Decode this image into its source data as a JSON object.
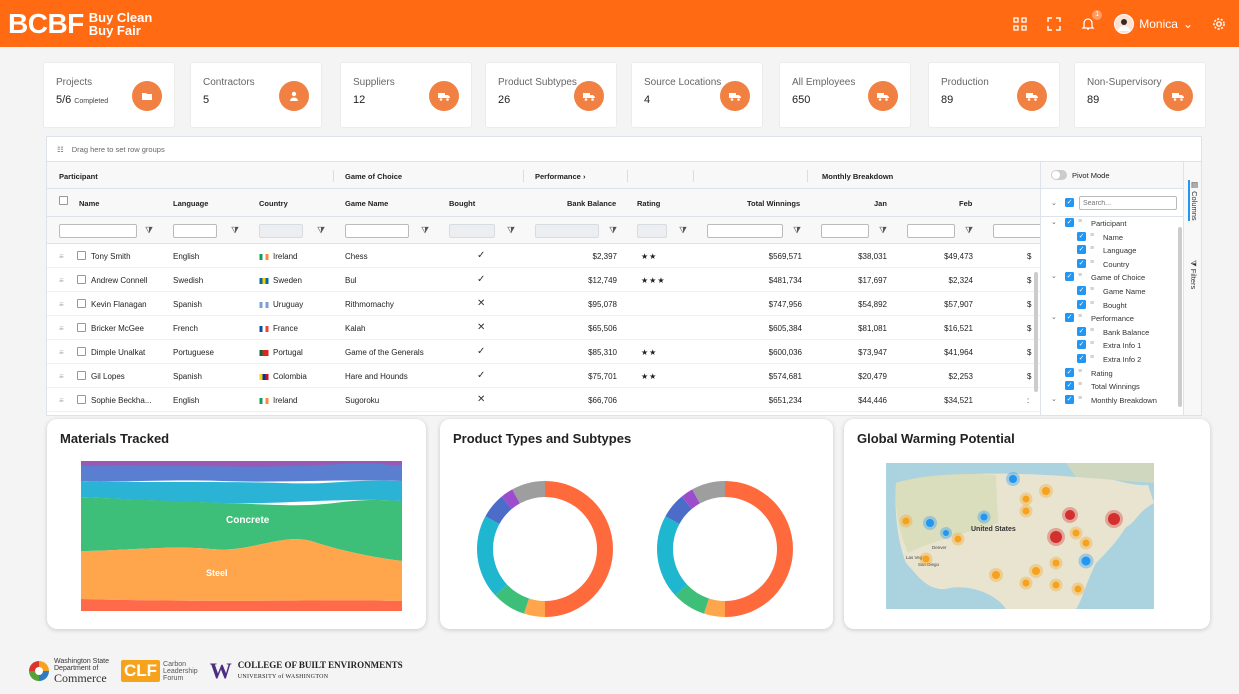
{
  "header": {
    "logo": "BCBF",
    "subtitle_line1": "Buy Clean",
    "subtitle_line2": "Buy Fair",
    "user_name": "Monica",
    "notification_count": "1",
    "brand_color": "#ff6a13"
  },
  "stats": [
    {
      "label": "Projects",
      "value": "5/6",
      "sub": "Completed",
      "icon": "folder-icon"
    },
    {
      "label": "Contractors",
      "value": "5",
      "sub": "",
      "icon": "person-icon"
    },
    {
      "label": "Suppliers",
      "value": "12",
      "sub": "",
      "icon": "truck-icon"
    },
    {
      "label": "Product Subtypes",
      "value": "26",
      "sub": "",
      "icon": "truck-icon"
    },
    {
      "label": "Source Locations",
      "value": "4",
      "sub": "",
      "icon": "truck-icon"
    },
    {
      "label": "All Employees",
      "value": "650",
      "sub": "",
      "icon": "truck-icon"
    },
    {
      "label": "Production",
      "value": "89",
      "sub": "",
      "icon": "truck-icon"
    },
    {
      "label": "Non-Supervisory",
      "value": "89",
      "sub": "",
      "icon": "truck-icon"
    }
  ],
  "grid": {
    "row_group_hint": "Drag here to set row groups",
    "groups": {
      "participant": "Participant",
      "game": "Game of Choice",
      "performance": "Performance",
      "monthly": "Monthly Breakdown"
    },
    "columns": {
      "name": "Name",
      "language": "Language",
      "country": "Country",
      "game_name": "Game Name",
      "bought": "Bought",
      "bank_balance": "Bank Balance",
      "rating": "Rating",
      "total_winnings": "Total Winnings",
      "jan": "Jan",
      "feb": "Feb"
    },
    "rows": [
      {
        "name": "Tony Smith",
        "language": "English",
        "country": "Ireland",
        "game": "Chess",
        "bought": "✓",
        "balance": "$2,397",
        "rating": "★★",
        "winnings": "$569,571",
        "jan": "$38,031",
        "feb": "$49,473",
        "more": "$"
      },
      {
        "name": "Andrew Connell",
        "language": "Swedish",
        "country": "Sweden",
        "game": "Bul",
        "bought": "✓",
        "balance": "$12,749",
        "rating": "★★★",
        "winnings": "$481,734",
        "jan": "$17,697",
        "feb": "$2,324",
        "more": "$"
      },
      {
        "name": "Kevin Flanagan",
        "language": "Spanish",
        "country": "Uruguay",
        "game": "Rithmomachy",
        "bought": "✕",
        "balance": "$95,078",
        "rating": "",
        "winnings": "$747,956",
        "jan": "$54,892",
        "feb": "$57,907",
        "more": "$"
      },
      {
        "name": "Bricker McGee",
        "language": "French",
        "country": "France",
        "game": "Kalah",
        "bought": "✕",
        "balance": "$65,506",
        "rating": "",
        "winnings": "$605,384",
        "jan": "$81,081",
        "feb": "$16,521",
        "more": "$"
      },
      {
        "name": "Dimple Unalkat",
        "language": "Portuguese",
        "country": "Portugal",
        "game": "Game of the Generals",
        "bought": "✓",
        "balance": "$85,310",
        "rating": "★★",
        "winnings": "$600,036",
        "jan": "$73,947",
        "feb": "$41,964",
        "more": "$"
      },
      {
        "name": "Gil Lopes",
        "language": "Spanish",
        "country": "Colombia",
        "game": "Hare and Hounds",
        "bought": "✓",
        "balance": "$75,701",
        "rating": "★★",
        "winnings": "$574,681",
        "jan": "$20,479",
        "feb": "$2,253",
        "more": "$"
      },
      {
        "name": "Sophie Beckha...",
        "language": "English",
        "country": "Ireland",
        "game": "Sugoroku",
        "bought": "✕",
        "balance": "$66,706",
        "rating": "",
        "winnings": "$651,234",
        "jan": "$44,446",
        "feb": "$34,521",
        "more": ":"
      }
    ],
    "flag_colors": {
      "Ireland": [
        "#169b62",
        "#ffffff",
        "#ff883e"
      ],
      "Sweden": [
        "#006aa7",
        "#fecc00",
        "#006aa7"
      ],
      "Uruguay": [
        "#7b9fd6",
        "#ffffff",
        "#7b9fd6"
      ],
      "France": [
        "#0055a4",
        "#ffffff",
        "#ef4135"
      ],
      "Portugal": [
        "#046a38",
        "#da291c",
        "#da291c"
      ],
      "Colombia": [
        "#fcd116",
        "#003893",
        "#ce1126"
      ]
    }
  },
  "tool_panel": {
    "pivot_mode": "Pivot Mode",
    "search_placeholder": "Search...",
    "tab_columns": "Columns",
    "tab_filters": "Filters",
    "items": [
      {
        "label": "Participant",
        "level": 0,
        "group": true
      },
      {
        "label": "Name",
        "level": 1,
        "group": false
      },
      {
        "label": "Language",
        "level": 1,
        "group": false
      },
      {
        "label": "Country",
        "level": 1,
        "group": false
      },
      {
        "label": "Game of Choice",
        "level": 0,
        "group": true
      },
      {
        "label": "Game Name",
        "level": 1,
        "group": false
      },
      {
        "label": "Bought",
        "level": 1,
        "group": false
      },
      {
        "label": "Performance",
        "level": 0,
        "group": true
      },
      {
        "label": "Bank Balance",
        "level": 1,
        "group": false
      },
      {
        "label": "Extra Info 1",
        "level": 1,
        "group": false
      },
      {
        "label": "Extra Info 2",
        "level": 1,
        "group": false
      },
      {
        "label": "Rating",
        "level": 0,
        "group": false
      },
      {
        "label": "Total Winnings",
        "level": 0,
        "group": false
      },
      {
        "label": "Monthly Breakdown",
        "level": 0,
        "group": true
      }
    ]
  },
  "panels": {
    "materials": {
      "title": "Materials Tracked",
      "labels": {
        "concrete": "Concrete",
        "steel": "Steel"
      },
      "colors": [
        "#ff6b4a",
        "#ffa64d",
        "#3dbf7a",
        "#2bb3d6",
        "#5a7fd1",
        "#9b59b6"
      ]
    },
    "product_types": {
      "title": "Product Types and Subtypes",
      "segments": [
        {
          "value": 50,
          "color": "#ff6a3d"
        },
        {
          "value": 5,
          "color": "#ffa64d"
        },
        {
          "value": 8,
          "color": "#3dbf7a"
        },
        {
          "value": 20,
          "color": "#1fb6d0"
        },
        {
          "value": 6,
          "color": "#4b6cc9"
        },
        {
          "value": 3,
          "color": "#9c4dcc"
        },
        {
          "value": 8,
          "color": "#9e9e9e"
        }
      ]
    },
    "gwp": {
      "title": "Global Warming Potential",
      "map_label": "United States",
      "map_cities": [
        "Denver",
        "Las Vegas",
        "San Diego"
      ]
    }
  },
  "footer": {
    "wa_line1": "Washington State",
    "wa_line2": "Department of",
    "wa_line3": "Commerce",
    "clf": "CLF",
    "clf_line1": "Carbon",
    "clf_line2": "Leadership",
    "clf_line3": "Forum",
    "uw_w": "W",
    "uw_line1": "COLLEGE OF BUILT ENVIRONMENTS",
    "uw_line2": "UNIVERSITY of WASHINGTON"
  }
}
